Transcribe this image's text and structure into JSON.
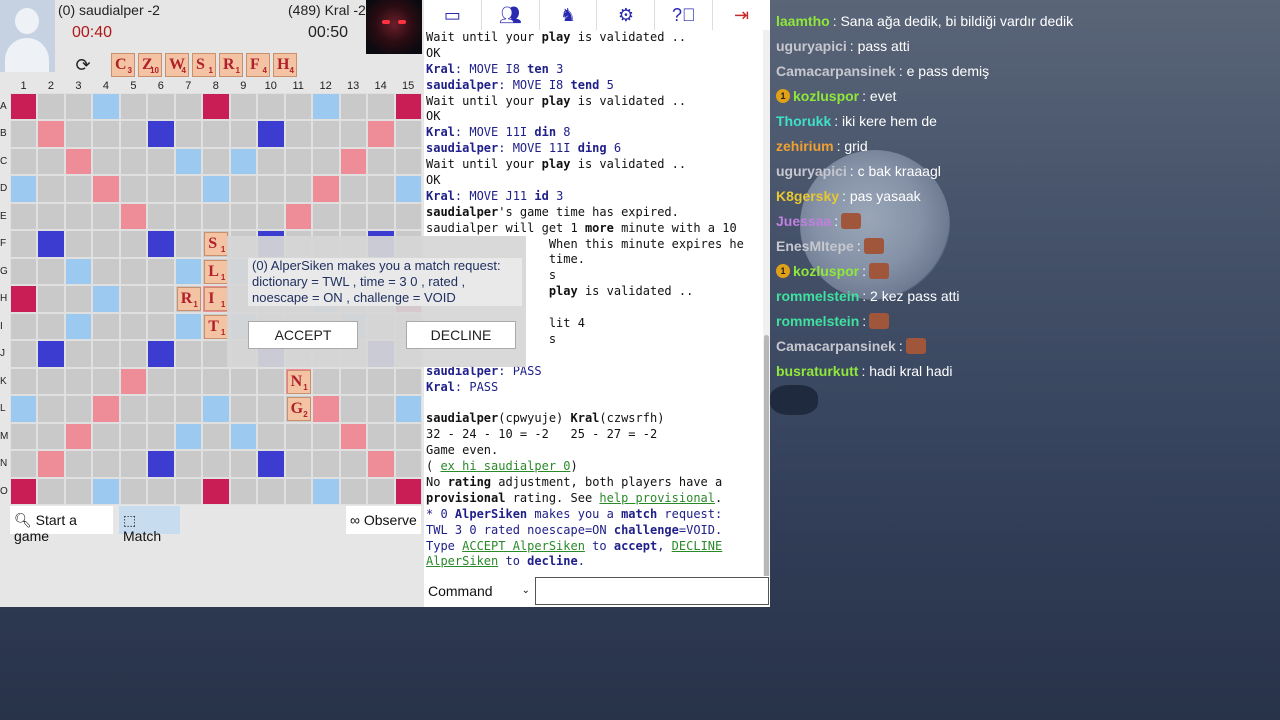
{
  "players": {
    "left": {
      "name": "(0) saudialper -2",
      "time": "00:40"
    },
    "right": {
      "name": "(489) Kral -2",
      "time": "00:50"
    }
  },
  "rack": [
    {
      "letter": "C",
      "value": "3"
    },
    {
      "letter": "Z",
      "value": "10"
    },
    {
      "letter": "W",
      "value": "4"
    },
    {
      "letter": "S",
      "value": "1"
    },
    {
      "letter": "R",
      "value": "1"
    },
    {
      "letter": "F",
      "value": "4"
    },
    {
      "letter": "H",
      "value": "4"
    }
  ],
  "board": {
    "columns": [
      "1",
      "2",
      "3",
      "4",
      "5",
      "6",
      "7",
      "8",
      "9",
      "10",
      "11",
      "12",
      "13",
      "14",
      "15"
    ],
    "rows": [
      "A",
      "B",
      "C",
      "D",
      "E",
      "F",
      "G",
      "H",
      "I",
      "J",
      "K",
      "L",
      "M",
      "N",
      "O"
    ],
    "tiles": [
      {
        "row": 5,
        "col": 7,
        "letter": "S",
        "value": "1"
      },
      {
        "row": 6,
        "col": 7,
        "letter": "L",
        "value": "1"
      },
      {
        "row": 7,
        "col": 6,
        "letter": "R",
        "value": "1"
      },
      {
        "row": 7,
        "col": 7,
        "letter": "I",
        "value": "1"
      },
      {
        "row": 8,
        "col": 7,
        "letter": "T",
        "value": "1"
      },
      {
        "row": 10,
        "col": 10,
        "letter": "N",
        "value": "1"
      },
      {
        "row": 11,
        "col": 10,
        "letter": "G",
        "value": "2"
      }
    ]
  },
  "buttons": {
    "start": "Start a game",
    "match": "Match",
    "observe": "Observe"
  },
  "dialog": {
    "text": "(0) AlperSiken makes you a match request: dictionary = TWL , time = 3 0 , rated , noescape = ON , challenge = VOID",
    "accept": "ACCEPT",
    "decline": "DECLINE"
  },
  "toolbar": [
    "monitor-icon",
    "users-icon",
    "horse-icon",
    "gear-icon",
    "help-icon",
    "logout-icon"
  ],
  "log": [
    [
      {
        "t": "Wait until your "
      },
      {
        "t": "play",
        "c": "b"
      },
      {
        "t": " is validated .."
      }
    ],
    [
      {
        "t": "OK"
      }
    ],
    [
      {
        "t": "Kral",
        "c": "nv b"
      },
      {
        "t": ": MOVE I8 ",
        "c": "nv"
      },
      {
        "t": "ten",
        "c": "nv b"
      },
      {
        "t": " 3",
        "c": "nv"
      }
    ],
    [
      {
        "t": "saudialper",
        "c": "nv b"
      },
      {
        "t": ": MOVE I8 ",
        "c": "nv"
      },
      {
        "t": "tend",
        "c": "nv b"
      },
      {
        "t": " 5",
        "c": "nv"
      }
    ],
    [
      {
        "t": "Wait until your "
      },
      {
        "t": "play",
        "c": "b"
      },
      {
        "t": " is validated .."
      }
    ],
    [
      {
        "t": "OK"
      }
    ],
    [
      {
        "t": "Kral",
        "c": "nv b"
      },
      {
        "t": ": MOVE 11I ",
        "c": "nv"
      },
      {
        "t": "din",
        "c": "nv b"
      },
      {
        "t": " 8",
        "c": "nv"
      }
    ],
    [
      {
        "t": "saudialper",
        "c": "nv b"
      },
      {
        "t": ": MOVE 11I ",
        "c": "nv"
      },
      {
        "t": "ding",
        "c": "nv b"
      },
      {
        "t": " 6",
        "c": "nv"
      }
    ],
    [
      {
        "t": "Wait until your "
      },
      {
        "t": "play",
        "c": "b"
      },
      {
        "t": " is validated .."
      }
    ],
    [
      {
        "t": "OK"
      }
    ],
    [
      {
        "t": "Kral",
        "c": "nv b"
      },
      {
        "t": ": MOVE J11 ",
        "c": "nv"
      },
      {
        "t": "id",
        "c": "nv b"
      },
      {
        "t": " 3",
        "c": "nv"
      }
    ],
    [
      {
        "t": "saudialper",
        "c": "b"
      },
      {
        "t": "'s game time has expired."
      }
    ],
    [
      {
        "t": "saudialper will get 1 "
      },
      {
        "t": "more",
        "c": "b"
      },
      {
        "t": " minute with a 10"
      }
    ],
    [
      {
        "t": "                 When this minute expires he"
      }
    ],
    [
      {
        "t": "                 time."
      }
    ],
    [
      {
        "t": "                 s"
      }
    ],
    [
      {
        "t": "                 "
      },
      {
        "t": "play",
        "c": "b"
      },
      {
        "t": " is validated .."
      }
    ],
    [
      {
        "t": ""
      }
    ],
    [
      {
        "t": "                 lit 4"
      }
    ],
    [
      {
        "t": "                 s"
      }
    ],
    [
      {
        "t": ""
      }
    ],
    [
      {
        "t": "saudialper",
        "c": "nv b"
      },
      {
        "t": ": PASS",
        "c": "nv"
      }
    ],
    [
      {
        "t": "Kral",
        "c": "nv b"
      },
      {
        "t": ": PASS",
        "c": "nv"
      }
    ],
    [
      {
        "t": ""
      }
    ],
    [
      {
        "t": "saudialper",
        "c": "b"
      },
      {
        "t": "(cpwyuje) "
      },
      {
        "t": "Kral",
        "c": "b"
      },
      {
        "t": "(czwsrfh)"
      }
    ],
    [
      {
        "t": "32 - 24 - 10 = -2   25 - 27 = -2"
      }
    ],
    [
      {
        "t": "Game even."
      }
    ],
    [
      {
        "t": "( "
      },
      {
        "t": "ex hi saudialper 0",
        "c": "gl"
      },
      {
        "t": ")"
      }
    ],
    [
      {
        "t": "No "
      },
      {
        "t": "rating",
        "c": "b"
      },
      {
        "t": " adjustment, both players have a"
      }
    ],
    [
      {
        "t": "provisional",
        "c": "b"
      },
      {
        "t": " rating. See "
      },
      {
        "t": "help provisional",
        "c": "gl"
      },
      {
        "t": "."
      }
    ],
    [
      {
        "t": "* 0 ",
        "c": "nv"
      },
      {
        "t": "AlperSiken",
        "c": "nv b"
      },
      {
        "t": " makes you a ",
        "c": "nv"
      },
      {
        "t": "match",
        "c": "nv b"
      },
      {
        "t": " request:",
        "c": "nv"
      }
    ],
    [
      {
        "t": "TWL 3 0 rated noescape=ON ",
        "c": "nv"
      },
      {
        "t": "challenge",
        "c": "nv b"
      },
      {
        "t": "=VOID.",
        "c": "nv"
      }
    ],
    [
      {
        "t": "Type ",
        "c": "nv"
      },
      {
        "t": "ACCEPT AlperSiken",
        "c": "gl"
      },
      {
        "t": " to ",
        "c": "nv"
      },
      {
        "t": "accept",
        "c": "nv b"
      },
      {
        "t": ", ",
        "c": "nv"
      },
      {
        "t": "DECLINE",
        "c": "gl"
      }
    ],
    [
      {
        "t": "AlperSiken",
        "c": "gl"
      },
      {
        "t": " to ",
        "c": "nv"
      },
      {
        "t": "decline",
        "c": "nv b"
      },
      {
        "t": ".",
        "c": "nv"
      }
    ]
  ],
  "command": {
    "selected": "Command",
    "input": ""
  },
  "chat": [
    {
      "user": "laamtho",
      "color": "#8fe83a",
      "text": " : Sana ağa dedik, bi bildiği vardır dedik"
    },
    {
      "user": "uguryapici",
      "color": "#c7c7cf",
      "text": " : pass atti"
    },
    {
      "user": "Camacarpansinek",
      "color": "#c7c7cf",
      "text": " : e pass demiş"
    },
    {
      "user": "kozluspor",
      "color": "#8fe83a",
      "badge": "1",
      "text": " : evet"
    },
    {
      "user": "Thorukk",
      "color": "#3fe0c8",
      "text": " : iki kere hem de"
    },
    {
      "user": "zehirium",
      "color": "#f0a032",
      "text": " : grid"
    },
    {
      "user": "uguryapici",
      "color": "#c7c7cf",
      "text": " : c bak kraaagl"
    },
    {
      "user": "K8gersky",
      "color": "#e8c832",
      "text": " : pas yasaak"
    },
    {
      "user": "Juessaa",
      "color": "#c080e0",
      "text": " :",
      "emote": "emote"
    },
    {
      "user": "EnesMItepe",
      "color": "#c7c7cf",
      "text": " :",
      "emote": "emote"
    },
    {
      "user": "kozluspor",
      "color": "#8fe83a",
      "badge": "1",
      "text": " :",
      "emote": "emote"
    },
    {
      "user": "rommelstein",
      "color": "#3fe0a0",
      "text": " : 2 kez pass atti"
    },
    {
      "user": "rommelstein",
      "color": "#3fe0a0",
      "text": " :",
      "emote": "emote"
    },
    {
      "user": "Camacarpansinek",
      "color": "#c7c7cf",
      "text": " :",
      "emote": "emote"
    },
    {
      "user": "busraturkutt",
      "color": "#8fe83a",
      "text": " : hadi kral hadi"
    }
  ]
}
